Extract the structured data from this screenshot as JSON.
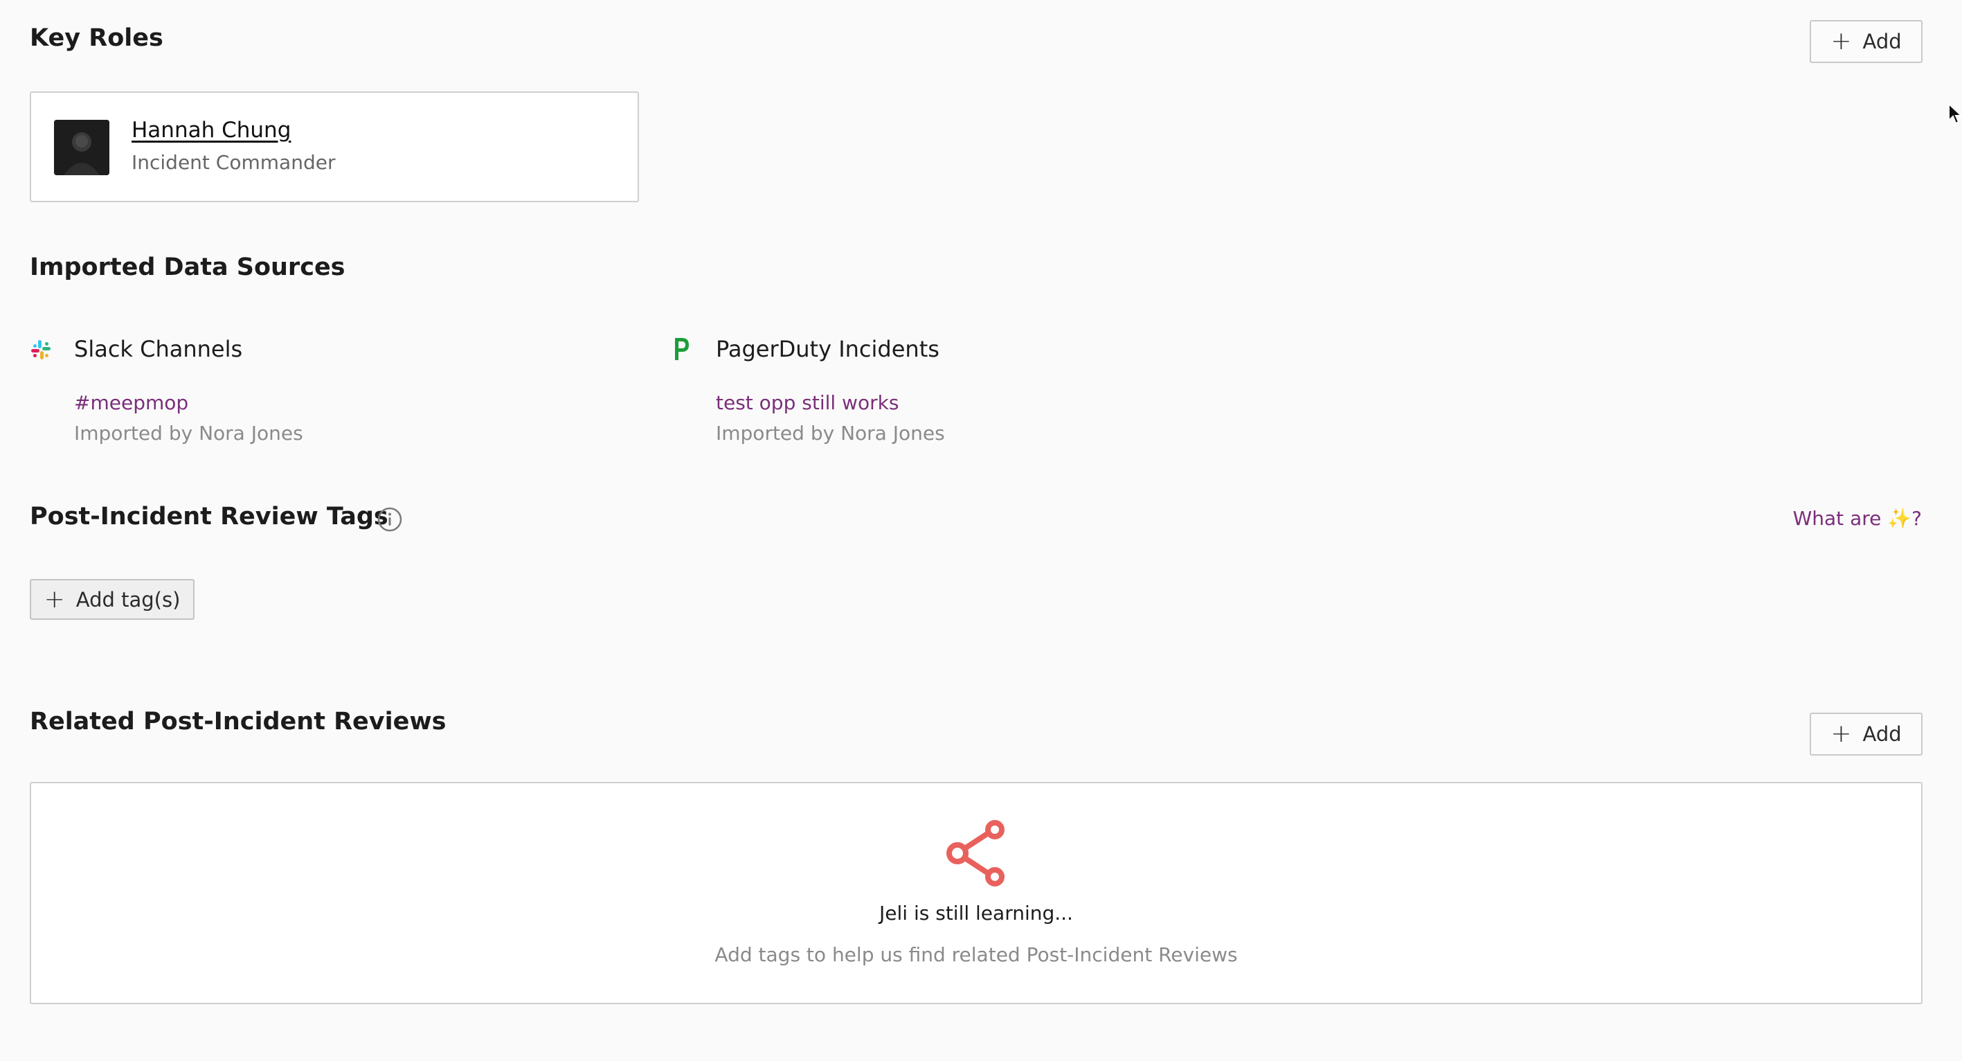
{
  "key_roles": {
    "title": "Key Roles",
    "add_label": "Add",
    "person": {
      "name": "Hannah Chung",
      "role": "Incident Commander"
    }
  },
  "data_sources": {
    "title": "Imported Data Sources",
    "slack": {
      "title": "Slack Channels",
      "item": "#meepmop",
      "meta": "Imported by Nora Jones",
      "icon": "slack-icon"
    },
    "pagerduty": {
      "title": "PagerDuty Incidents",
      "item": "test opp still works",
      "meta": "Imported by Nora Jones",
      "icon": "pagerduty-icon"
    }
  },
  "tags": {
    "title": "Post-Incident Review Tags",
    "what_are_prefix": "What are",
    "what_are_suffix": "?",
    "add_tags_label": "Add tag(s)"
  },
  "related": {
    "title": "Related Post-Incident Reviews",
    "add_label": "Add",
    "empty_title": "Jeli is still learning...",
    "empty_subtitle": "Add tags to help us find related Post-Incident Reviews"
  },
  "colors": {
    "link": "#7a2f7a",
    "share_icon": "#e8615d",
    "pagerduty": "#1b9e3a"
  }
}
